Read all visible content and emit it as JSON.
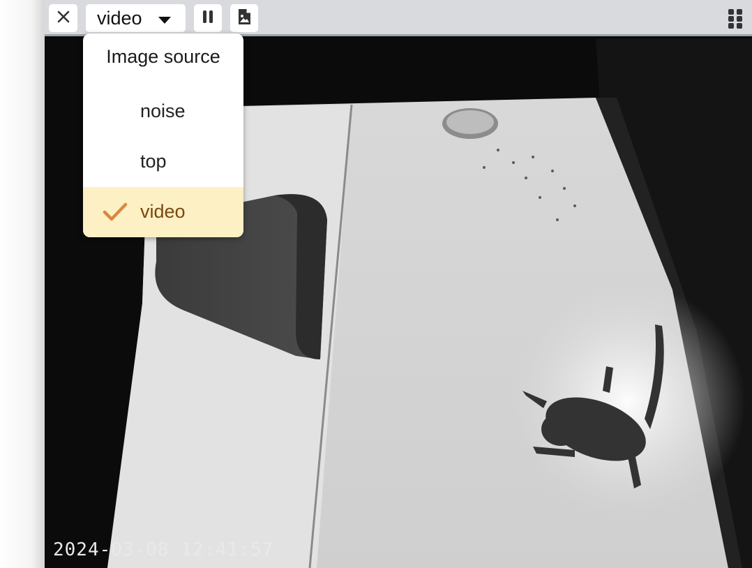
{
  "toolbar": {
    "close_icon": "close-icon",
    "source_value": "video",
    "caret_icon": "caret-down-icon",
    "pause_icon": "pause-icon",
    "snapshot_icon": "image-file-icon",
    "grip_icon": "drag-grip-icon"
  },
  "dropdown": {
    "header": "Image source",
    "options": [
      {
        "label": "noise",
        "selected": false
      },
      {
        "label": "top",
        "selected": false
      },
      {
        "label": "video",
        "selected": true
      }
    ],
    "check_icon": "checkmark-icon"
  },
  "feed": {
    "timestamp": "2024-03-08 12:41:57"
  },
  "colors": {
    "toolbar_bg": "#d8dadd",
    "selected_bg": "#fcf0c4",
    "check": "#d8893e",
    "selected_text": "#7a4710"
  }
}
